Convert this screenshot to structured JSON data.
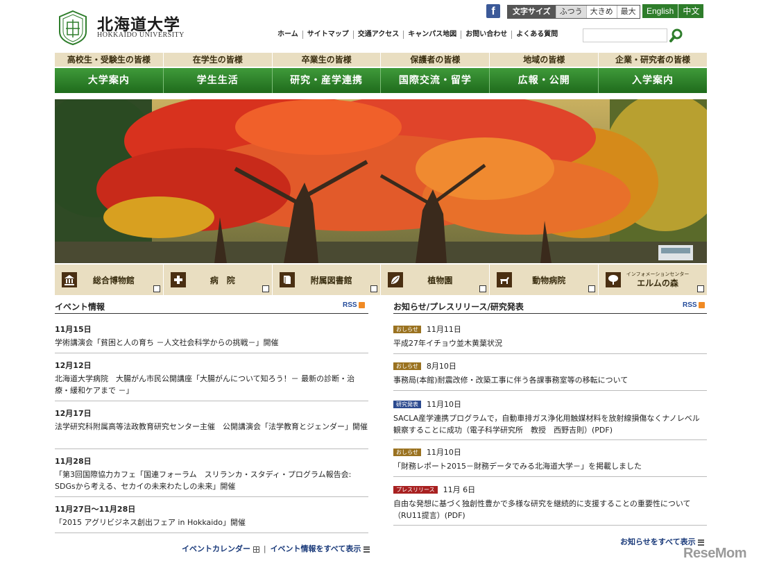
{
  "header": {
    "logo_jp": "北海道大学",
    "logo_en": "HOKKAIDO UNIVERSITY",
    "facebook_glyph": "f",
    "font_size": {
      "label": "文字サイズ",
      "options": [
        "ふつう",
        "大きめ",
        "最大"
      ],
      "selected": "ふつう"
    },
    "languages": [
      "English",
      "中文"
    ],
    "util_nav": [
      "ホーム",
      "サイトマップ",
      "交通アクセス",
      "キャンパス地図",
      "お問い合わせ",
      "よくある質問"
    ],
    "search": {
      "value": "",
      "placeholder": ""
    }
  },
  "audience_nav": [
    "高校生・受験生の皆様",
    "在学生の皆様",
    "卒業生の皆様",
    "保護者の皆様",
    "地域の皆様",
    "企業・研究者の皆様"
  ],
  "main_nav": [
    "大学案内",
    "学生生活",
    "研究・産学連携",
    "国際交流・留学",
    "広報・公開",
    "入学案内"
  ],
  "facilities": [
    {
      "label": "総合博物館",
      "sub": "",
      "icon": "museum-icon"
    },
    {
      "label": "病　院",
      "sub": "",
      "icon": "hospital-cross-icon"
    },
    {
      "label": "附属図書館",
      "sub": "",
      "icon": "library-book-icon"
    },
    {
      "label": "植物園",
      "sub": "",
      "icon": "leaf-icon"
    },
    {
      "label": "動物病院",
      "sub": "",
      "icon": "animal-icon"
    },
    {
      "label": "エルムの森",
      "sub": "インフォメーションセンター",
      "icon": "tree-icon"
    }
  ],
  "events": {
    "title": "イベント情報",
    "rss": "RSS",
    "items": [
      {
        "date": "11月15日",
        "text": "学術講演会「貧困と人の育ち －人文社会科学からの挑戦－」開催"
      },
      {
        "date": "12月12日",
        "text": "北海道大学病院　大腸がん市民公開講座「大腸がんについて知ろう！－ 最新の診断・治療・緩和ケアまで －」"
      },
      {
        "date": "12月17日",
        "text": "法学研究科附属高等法政教育研究センター主催　公開講演会「法学教育とジェンダー」開催"
      },
      {
        "date": "11月28日",
        "text": "「第3回国際協力カフェ「国連フォーラム　スリランカ・スタディ・プログラム報告会: SDGsから考える、セカイの未来わたしの未来」開催"
      },
      {
        "date": "11月27日～11月28日",
        "text": "「2015 アグリビジネス創出フェア in Hokkaido」開催"
      }
    ],
    "calendar_link": "イベントカレンダー",
    "all_link": "イベント情報をすべて表示"
  },
  "news": {
    "title": "お知らせ/プレスリリース/研究発表",
    "rss": "RSS",
    "items": [
      {
        "badge": "おしらせ",
        "badge_type": "info",
        "date": "11月11日",
        "text": "平成27年イチョウ並木黄葉状況"
      },
      {
        "badge": "おしらせ",
        "badge_type": "info",
        "date": "8月10日",
        "text": "事務局(本館)耐震改修・改築工事に伴う各課事務室等の移転について"
      },
      {
        "badge": "研究発表",
        "badge_type": "research",
        "date": "11月10日",
        "text": "SACLA産学連携プログラムで，自動車排ガス浄化用触媒材料を放射線損傷なくナノレベル観察することに成功（電子科学研究所　教授　西野吉則）(PDF)"
      },
      {
        "badge": "おしらせ",
        "badge_type": "info",
        "date": "11月10日",
        "text": "「財務レポート2015－財務データでみる北海道大学－」を掲載しました"
      },
      {
        "badge": "プレスリリース",
        "badge_type": "press",
        "date": "11月 6日",
        "text": "自由な発想に基づく独創性豊かで多様な研究を継続的に支援することの重要性について（RU11提言）(PDF)"
      }
    ],
    "all_link": "お知らせをすべて表示"
  },
  "watermark": "ReseMom"
}
